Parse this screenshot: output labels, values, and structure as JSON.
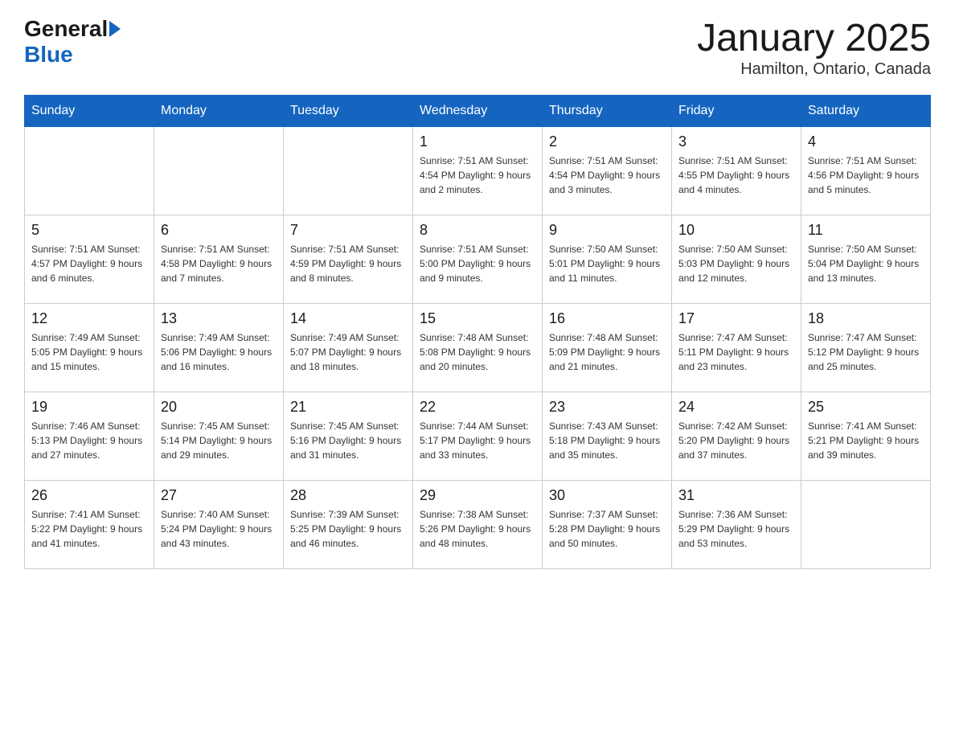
{
  "logo": {
    "general": "General",
    "blue": "Blue"
  },
  "header": {
    "title": "January 2025",
    "location": "Hamilton, Ontario, Canada"
  },
  "days_of_week": [
    "Sunday",
    "Monday",
    "Tuesday",
    "Wednesday",
    "Thursday",
    "Friday",
    "Saturday"
  ],
  "weeks": [
    [
      {
        "day": "",
        "info": ""
      },
      {
        "day": "",
        "info": ""
      },
      {
        "day": "",
        "info": ""
      },
      {
        "day": "1",
        "info": "Sunrise: 7:51 AM\nSunset: 4:54 PM\nDaylight: 9 hours and 2 minutes."
      },
      {
        "day": "2",
        "info": "Sunrise: 7:51 AM\nSunset: 4:54 PM\nDaylight: 9 hours and 3 minutes."
      },
      {
        "day": "3",
        "info": "Sunrise: 7:51 AM\nSunset: 4:55 PM\nDaylight: 9 hours and 4 minutes."
      },
      {
        "day": "4",
        "info": "Sunrise: 7:51 AM\nSunset: 4:56 PM\nDaylight: 9 hours and 5 minutes."
      }
    ],
    [
      {
        "day": "5",
        "info": "Sunrise: 7:51 AM\nSunset: 4:57 PM\nDaylight: 9 hours and 6 minutes."
      },
      {
        "day": "6",
        "info": "Sunrise: 7:51 AM\nSunset: 4:58 PM\nDaylight: 9 hours and 7 minutes."
      },
      {
        "day": "7",
        "info": "Sunrise: 7:51 AM\nSunset: 4:59 PM\nDaylight: 9 hours and 8 minutes."
      },
      {
        "day": "8",
        "info": "Sunrise: 7:51 AM\nSunset: 5:00 PM\nDaylight: 9 hours and 9 minutes."
      },
      {
        "day": "9",
        "info": "Sunrise: 7:50 AM\nSunset: 5:01 PM\nDaylight: 9 hours and 11 minutes."
      },
      {
        "day": "10",
        "info": "Sunrise: 7:50 AM\nSunset: 5:03 PM\nDaylight: 9 hours and 12 minutes."
      },
      {
        "day": "11",
        "info": "Sunrise: 7:50 AM\nSunset: 5:04 PM\nDaylight: 9 hours and 13 minutes."
      }
    ],
    [
      {
        "day": "12",
        "info": "Sunrise: 7:49 AM\nSunset: 5:05 PM\nDaylight: 9 hours and 15 minutes."
      },
      {
        "day": "13",
        "info": "Sunrise: 7:49 AM\nSunset: 5:06 PM\nDaylight: 9 hours and 16 minutes."
      },
      {
        "day": "14",
        "info": "Sunrise: 7:49 AM\nSunset: 5:07 PM\nDaylight: 9 hours and 18 minutes."
      },
      {
        "day": "15",
        "info": "Sunrise: 7:48 AM\nSunset: 5:08 PM\nDaylight: 9 hours and 20 minutes."
      },
      {
        "day": "16",
        "info": "Sunrise: 7:48 AM\nSunset: 5:09 PM\nDaylight: 9 hours and 21 minutes."
      },
      {
        "day": "17",
        "info": "Sunrise: 7:47 AM\nSunset: 5:11 PM\nDaylight: 9 hours and 23 minutes."
      },
      {
        "day": "18",
        "info": "Sunrise: 7:47 AM\nSunset: 5:12 PM\nDaylight: 9 hours and 25 minutes."
      }
    ],
    [
      {
        "day": "19",
        "info": "Sunrise: 7:46 AM\nSunset: 5:13 PM\nDaylight: 9 hours and 27 minutes."
      },
      {
        "day": "20",
        "info": "Sunrise: 7:45 AM\nSunset: 5:14 PM\nDaylight: 9 hours and 29 minutes."
      },
      {
        "day": "21",
        "info": "Sunrise: 7:45 AM\nSunset: 5:16 PM\nDaylight: 9 hours and 31 minutes."
      },
      {
        "day": "22",
        "info": "Sunrise: 7:44 AM\nSunset: 5:17 PM\nDaylight: 9 hours and 33 minutes."
      },
      {
        "day": "23",
        "info": "Sunrise: 7:43 AM\nSunset: 5:18 PM\nDaylight: 9 hours and 35 minutes."
      },
      {
        "day": "24",
        "info": "Sunrise: 7:42 AM\nSunset: 5:20 PM\nDaylight: 9 hours and 37 minutes."
      },
      {
        "day": "25",
        "info": "Sunrise: 7:41 AM\nSunset: 5:21 PM\nDaylight: 9 hours and 39 minutes."
      }
    ],
    [
      {
        "day": "26",
        "info": "Sunrise: 7:41 AM\nSunset: 5:22 PM\nDaylight: 9 hours and 41 minutes."
      },
      {
        "day": "27",
        "info": "Sunrise: 7:40 AM\nSunset: 5:24 PM\nDaylight: 9 hours and 43 minutes."
      },
      {
        "day": "28",
        "info": "Sunrise: 7:39 AM\nSunset: 5:25 PM\nDaylight: 9 hours and 46 minutes."
      },
      {
        "day": "29",
        "info": "Sunrise: 7:38 AM\nSunset: 5:26 PM\nDaylight: 9 hours and 48 minutes."
      },
      {
        "day": "30",
        "info": "Sunrise: 7:37 AM\nSunset: 5:28 PM\nDaylight: 9 hours and 50 minutes."
      },
      {
        "day": "31",
        "info": "Sunrise: 7:36 AM\nSunset: 5:29 PM\nDaylight: 9 hours and 53 minutes."
      },
      {
        "day": "",
        "info": ""
      }
    ]
  ]
}
